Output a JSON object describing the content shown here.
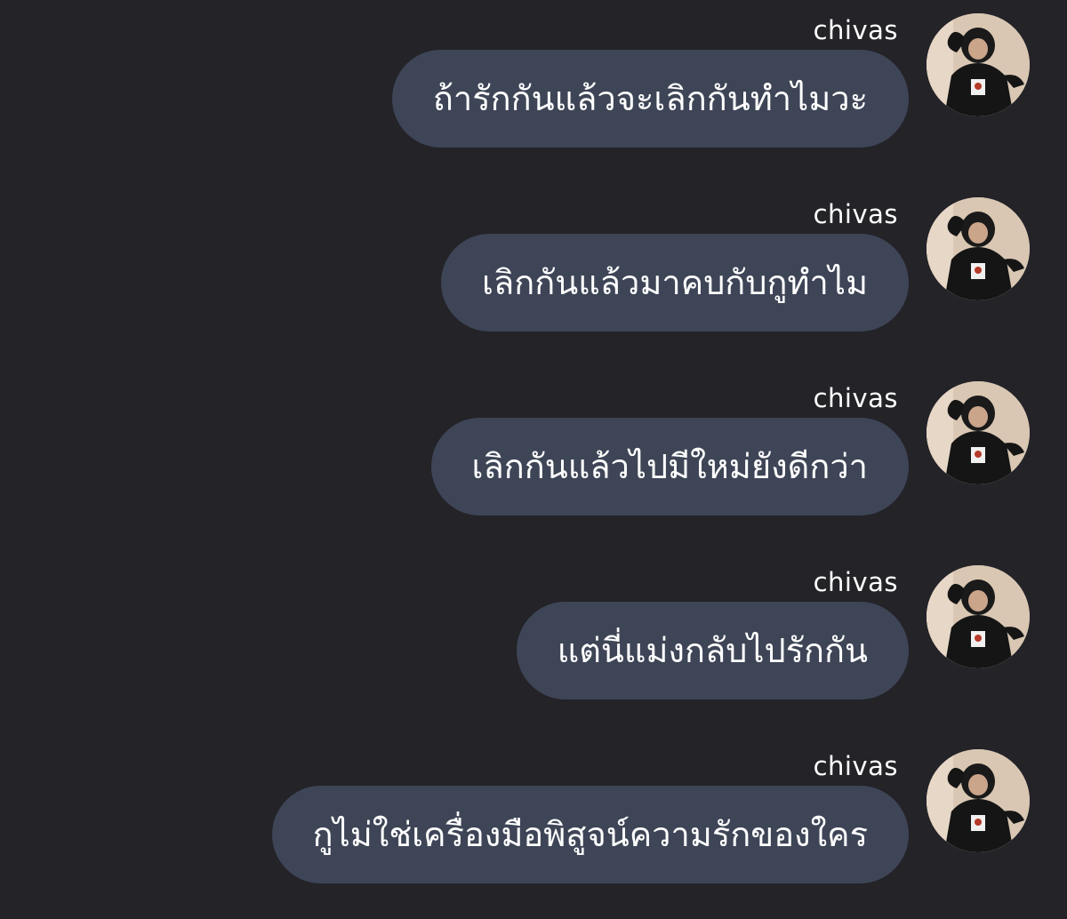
{
  "messages": [
    {
      "sender": "chivas",
      "text": "ถ้ารักกันแล้วจะเลิกกันทำไมวะ"
    },
    {
      "sender": "chivas",
      "text": "เลิกกันแล้วมาคบกับกูทำไม"
    },
    {
      "sender": "chivas",
      "text": "เลิกกันแล้วไปมีใหม่ยังดีกว่า"
    },
    {
      "sender": "chivas",
      "text": "แต่นี่แม่งกลับไปรักกัน"
    },
    {
      "sender": "chivas",
      "text": "กูไม่ใช่เครื่องมือพิสูจน์ความรักของใคร"
    }
  ],
  "avatar_icon": "user-avatar-hoodie",
  "colors": {
    "background": "#232328",
    "bubble": "#3e4556",
    "text": "#ffffff"
  }
}
